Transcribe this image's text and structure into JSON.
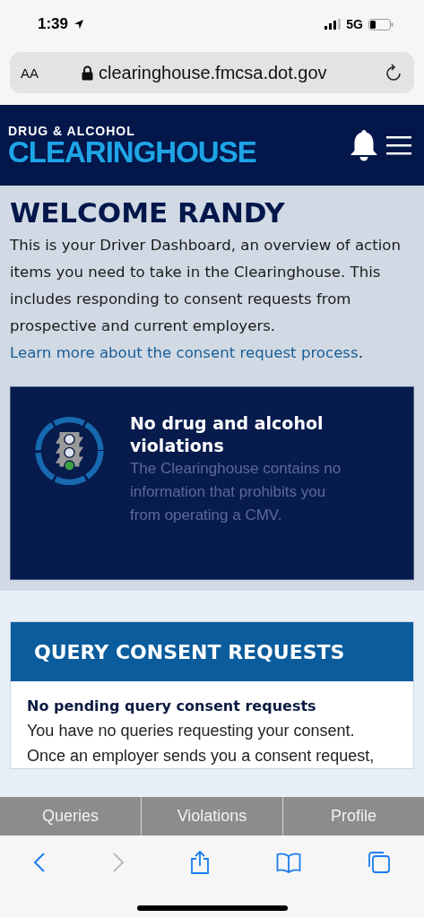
{
  "status_bar": {
    "time": "1:39",
    "network": "5G"
  },
  "browser": {
    "text_size": "AA",
    "url": "clearinghouse.fmcsa.dot.gov"
  },
  "header": {
    "logo_top": "DRUG & ALCOHOL",
    "logo_bottom": "CLEARINGHOUSE"
  },
  "welcome": {
    "title": "WELCOME RANDY",
    "intro": "This is your Driver Dashboard, an overview of action items you need to take in the Clearinghouse. This includes responding to consent requests from prospective and current employers.",
    "link": [
      "Learn more about the consent",
      "request process"
    ],
    "after_link": "."
  },
  "status_card": {
    "title": "No drug and alcohol violations",
    "text": "The Clearinghouse contains no information that prohibits you from operating a CMV."
  },
  "query_card": {
    "title": "QUERY CONSENT REQUESTS",
    "subtitle": "No pending query consent requests",
    "text": "You have no queries requesting your consent. Once an employer sends you a consent request,"
  },
  "bottom_tabs": [
    {
      "label": "Queries"
    },
    {
      "label": "Violations"
    },
    {
      "label": "Profile"
    }
  ]
}
